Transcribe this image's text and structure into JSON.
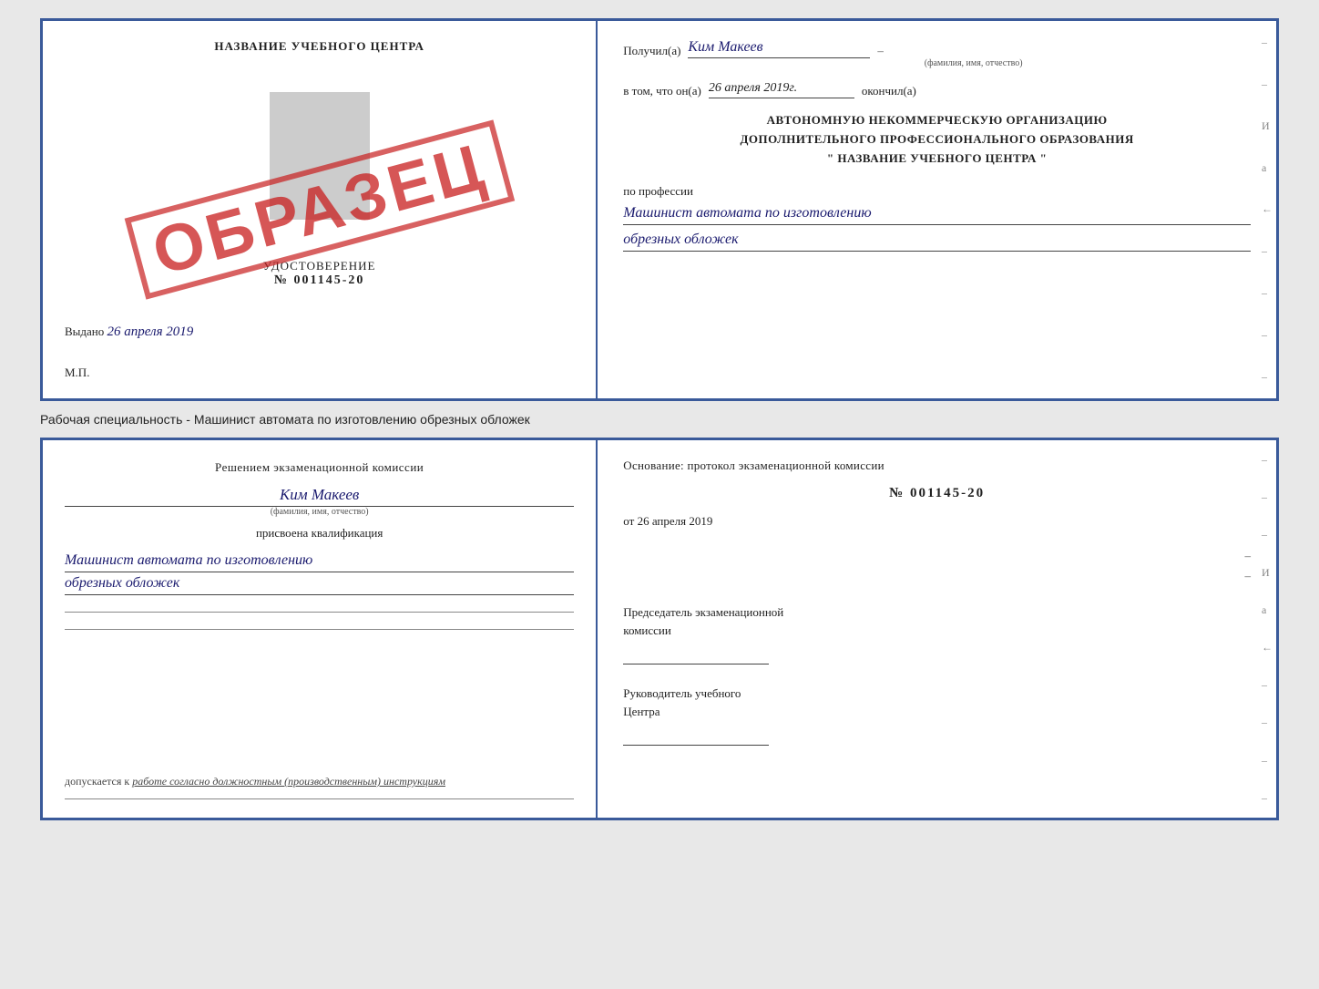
{
  "page": {
    "background": "#e8e8e8"
  },
  "top_certificate": {
    "left": {
      "school_name": "НАЗВАНИЕ УЧЕБНОГО ЦЕНТРА",
      "photo_placeholder": "",
      "stamp": "ОБРАЗЕЦ",
      "udostoverenie_title": "УДОСТОВЕРЕНИЕ",
      "udostoverenie_number": "№ 001145-20",
      "vydano_label": "Выдано",
      "vydano_value": "26 апреля 2019",
      "mp_label": "М.П."
    },
    "right": {
      "poluchil_label": "Получил(а)",
      "poluchil_value": "Ким Макеев",
      "poluchil_subtext": "(фамилия, имя, отчество)",
      "dash1": "–",
      "vtom_label": "в том, что он(а)",
      "vtom_value": "26 апреля 2019г.",
      "okonchil_label": "окончил(а)",
      "center_org": "АВТОНОМНУЮ НЕКОММЕРЧЕСКУЮ ОРГАНИЗАЦИЮ",
      "center_org2": "ДОПОЛНИТЕЛЬНОГО ПРОФЕССИОНАЛЬНОГО ОБРАЗОВАНИЯ",
      "center_name_quotes": "\"  НАЗВАНИЕ УЧЕБНОГО ЦЕНТРА  \"",
      "dash2": "–",
      "dash3": "–",
      "i_label": "И",
      "a_label": "а",
      "left_arrow": "←",
      "po_professii_label": "по профессии",
      "profession_value1": "Машинист автомата по изготовлению",
      "profession_value2": "обрезных обложек",
      "dash4": "–",
      "dash5": "–",
      "dash6": "–"
    }
  },
  "specialty_text": "Рабочая специальность - Машинист автомата по изготовлению обрезных обложек",
  "bottom_certificate": {
    "left": {
      "resheniem_text": "Решением экзаменационной комиссии",
      "name_value": "Ким Макеев",
      "name_subtext": "(фамилия, имя, отчество)",
      "prisvoena_text": "присвоена квалификация",
      "qualification1": "Машинист автомата по изготовлению",
      "qualification2": "обрезных обложек",
      "line1": "",
      "line2": "",
      "dopuskaetsya_label": "допускается к",
      "dopuskaetsya_value": "работе согласно должностным (производственным) инструкциям",
      "line3": ""
    },
    "right": {
      "osnovaniye_label": "Основание: протокол экзаменационной комиссии",
      "protocol_number": "№ 001145-20",
      "protocol_date_of": "от",
      "protocol_date_value": "26 апреля 2019",
      "dash1": "–",
      "dash2": "–",
      "predsedatel_label": "Председатель экзаменационной",
      "predsedatel_label2": "комиссии",
      "dash3": "–",
      "i_label": "И",
      "a_label": "а",
      "left_arrow": "←",
      "rukovoditel_label": "Руководитель учебного",
      "rukovoditel_label2": "Центра",
      "dash4": "–",
      "dash5": "–",
      "dash6": "–",
      "dash7": "–"
    }
  }
}
